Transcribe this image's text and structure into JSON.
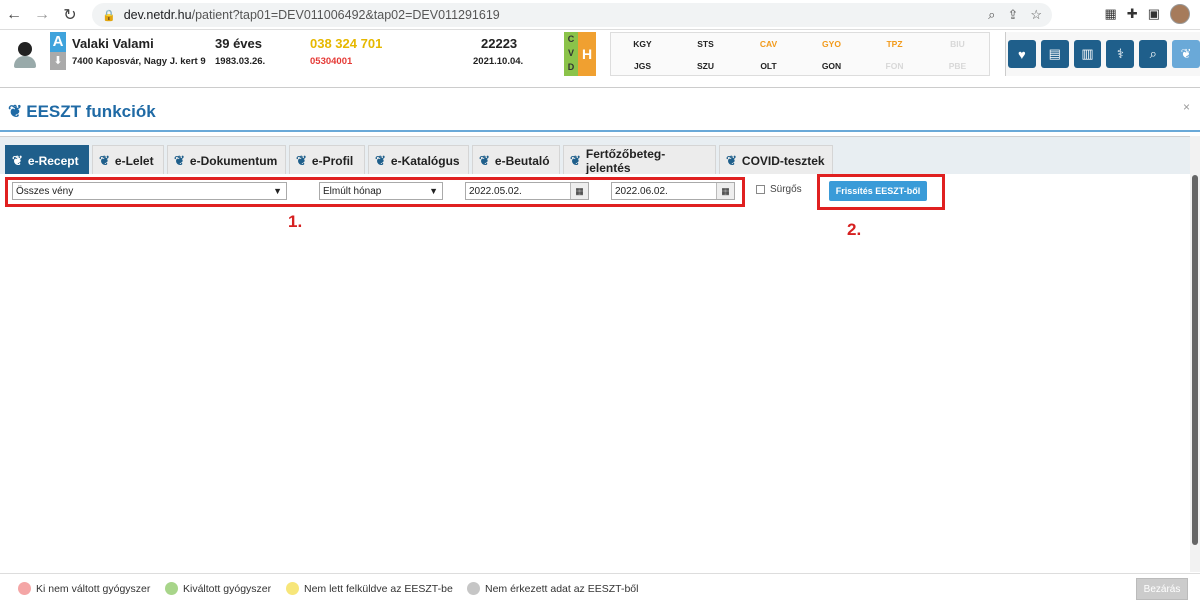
{
  "browser": {
    "url_host": "dev.netdr.hu",
    "url_path": "/patient?tap01=DEV011006492&tap02=DEV011291619"
  },
  "patient": {
    "blood_group": "A",
    "name": "Valaki Valami",
    "address": "7400 Kaposvár, Nagy J. kert 9",
    "age": "39 éves",
    "dob": "1983.03.26.",
    "phone": "038 324 701",
    "taj": "05304001",
    "id_number": "22223",
    "id_date": "2021.10.04.",
    "cvd_letters": [
      "C",
      "V",
      "D"
    ],
    "h_label": "H",
    "colors": {
      "blood": "#3fa3dc",
      "phone": "#e6b800",
      "taj": "#e53935",
      "cvd": "#8bc34a",
      "h": "#f0a030"
    }
  },
  "risk_codes": [
    {
      "label": "KGY",
      "color": "#222222"
    },
    {
      "label": "STS",
      "color": "#222222"
    },
    {
      "label": "CAV",
      "color": "#f29a1a"
    },
    {
      "label": "GYO",
      "color": "#f29a1a"
    },
    {
      "label": "TPZ",
      "color": "#f29a1a"
    },
    {
      "label": "BIU",
      "color": "#d8d8d8"
    },
    {
      "label": "JGS",
      "color": "#222222"
    },
    {
      "label": "SZU",
      "color": "#222222"
    },
    {
      "label": "OLT",
      "color": "#222222"
    },
    {
      "label": "GON",
      "color": "#222222"
    },
    {
      "label": "FON",
      "color": "#d8d8d8"
    },
    {
      "label": "PBE",
      "color": "#d8d8d8"
    }
  ],
  "quick_buttons": [
    "heart-icon",
    "document-icon",
    "books-icon",
    "pharmacist-icon",
    "search-icon",
    "eeszt-icon"
  ],
  "modal": {
    "title": "EESZT funkciók",
    "close": "×"
  },
  "tabs": [
    {
      "label": "e-Recept",
      "active": true
    },
    {
      "label": "e-Lelet",
      "active": false
    },
    {
      "label": "e-Dokumentum",
      "active": false
    },
    {
      "label": "e-Profil",
      "active": false
    },
    {
      "label": "e-Katalógus",
      "active": false
    },
    {
      "label": "e-Beutaló",
      "active": false
    },
    {
      "label": "Fertőzőbeteg-jelentés",
      "active": false
    },
    {
      "label": "COVID-tesztek",
      "active": false
    }
  ],
  "filters": {
    "prescription_type": "Összes vény",
    "period": "Elmúlt hónap",
    "date_from": "2022.05.02.",
    "date_to": "2022.06.02.",
    "urgent_label": "Sürgős",
    "refresh_label": "Frissítés EESZT-ből"
  },
  "annotations": {
    "one": "1.",
    "two": "2."
  },
  "legend": [
    {
      "label": "Ki nem váltott gyógyszer",
      "color": "#f4a6a6"
    },
    {
      "label": "Kiváltott gyógyszer",
      "color": "#a8d58a"
    },
    {
      "label": "Nem lett felküldve az EESZT-be",
      "color": "#f7e67a"
    },
    {
      "label": "Nem érkezett adat az EESZT-ből",
      "color": "#c6c6c6"
    }
  ],
  "footer": {
    "close_label": "Bezárás"
  }
}
